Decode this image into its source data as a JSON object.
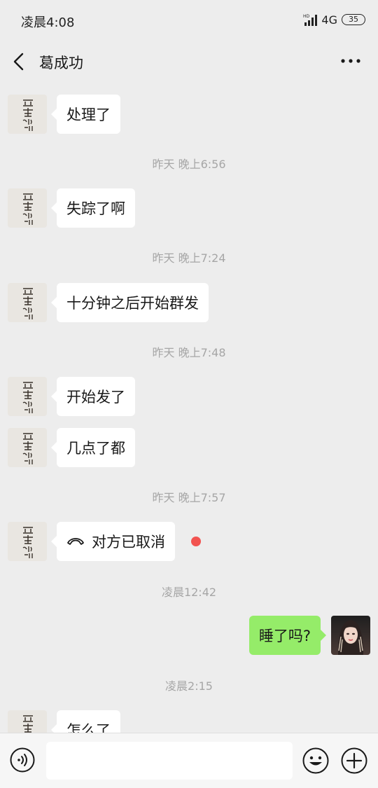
{
  "status_bar": {
    "time": "凌晨4:08",
    "network": "4G",
    "battery": "35"
  },
  "header": {
    "title": "葛成功"
  },
  "messages": [
    {
      "type": "text",
      "side": "left",
      "text": "处理了"
    },
    {
      "type": "time",
      "text": "昨天 晚上6:56"
    },
    {
      "type": "text",
      "side": "left",
      "text": "失踪了啊"
    },
    {
      "type": "time",
      "text": "昨天 晚上7:24"
    },
    {
      "type": "text",
      "side": "left",
      "text": "十分钟之后开始群发"
    },
    {
      "type": "time",
      "text": "昨天 晚上7:48"
    },
    {
      "type": "text",
      "side": "left",
      "text": "开始发了"
    },
    {
      "type": "text",
      "side": "left",
      "text": "几点了都"
    },
    {
      "type": "time",
      "text": "昨天 晚上7:57"
    },
    {
      "type": "call",
      "side": "left",
      "text": "对方已取消",
      "icon": "phone-hangup-icon",
      "unread": true
    },
    {
      "type": "time",
      "text": "凌晨12:42"
    },
    {
      "type": "text",
      "side": "right",
      "text": "睡了吗?"
    },
    {
      "type": "time",
      "text": "凌晨2:15"
    },
    {
      "type": "text",
      "side": "left",
      "text": "怎么了"
    }
  ],
  "input_bar": {
    "value": ""
  },
  "colors": {
    "background": "#ededed",
    "my_bubble": "#95ec69",
    "their_bubble": "#ffffff",
    "unread_dot": "#f25350"
  }
}
